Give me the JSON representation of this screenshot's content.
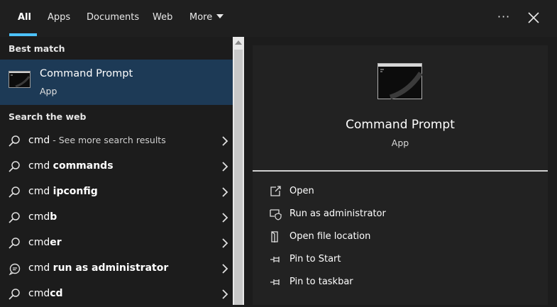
{
  "tabs": [
    {
      "label": "All",
      "active": true
    },
    {
      "label": "Apps"
    },
    {
      "label": "Documents"
    },
    {
      "label": "Web"
    },
    {
      "label": "More"
    }
  ],
  "header": {
    "options_icon": "ellipsis-icon",
    "close_icon": "close-icon",
    "dots": "···"
  },
  "left": {
    "best_match_heading": "Best match",
    "best_match": {
      "title": "Command Prompt",
      "subtitle": "App",
      "icon": "terminal-icon"
    },
    "web_heading": "Search the web",
    "results": [
      {
        "prefix": "cmd",
        "bold": "",
        "suffix": " - See more search results",
        "icon": "search-icon"
      },
      {
        "prefix": "cmd ",
        "bold": "commands",
        "suffix": "",
        "icon": "search-icon"
      },
      {
        "prefix": "cmd ",
        "bold": "ipconfig",
        "suffix": "",
        "icon": "search-icon"
      },
      {
        "prefix": "cmd",
        "bold": "b",
        "suffix": "",
        "icon": "search-icon"
      },
      {
        "prefix": "cmd",
        "bold": "er",
        "suffix": "",
        "icon": "search-icon"
      },
      {
        "prefix": "cmd ",
        "bold": "run as administrator",
        "suffix": "",
        "icon": "chat-icon"
      },
      {
        "prefix": "cmd",
        "bold": "cd",
        "suffix": "",
        "icon": "search-icon"
      }
    ]
  },
  "detail": {
    "title": "Command Prompt",
    "subtitle": "App",
    "actions": [
      {
        "label": "Open",
        "icon": "open-icon"
      },
      {
        "label": "Run as administrator",
        "icon": "shield-icon"
      },
      {
        "label": "Open file location",
        "icon": "folder-icon"
      },
      {
        "label": "Pin to Start",
        "icon": "pin-icon"
      },
      {
        "label": "Pin to taskbar",
        "icon": "pin-icon"
      }
    ]
  },
  "colors": {
    "accent": "#4cc2ff",
    "selected_bg": "#1d3a56",
    "background": "#1c1c1c"
  }
}
